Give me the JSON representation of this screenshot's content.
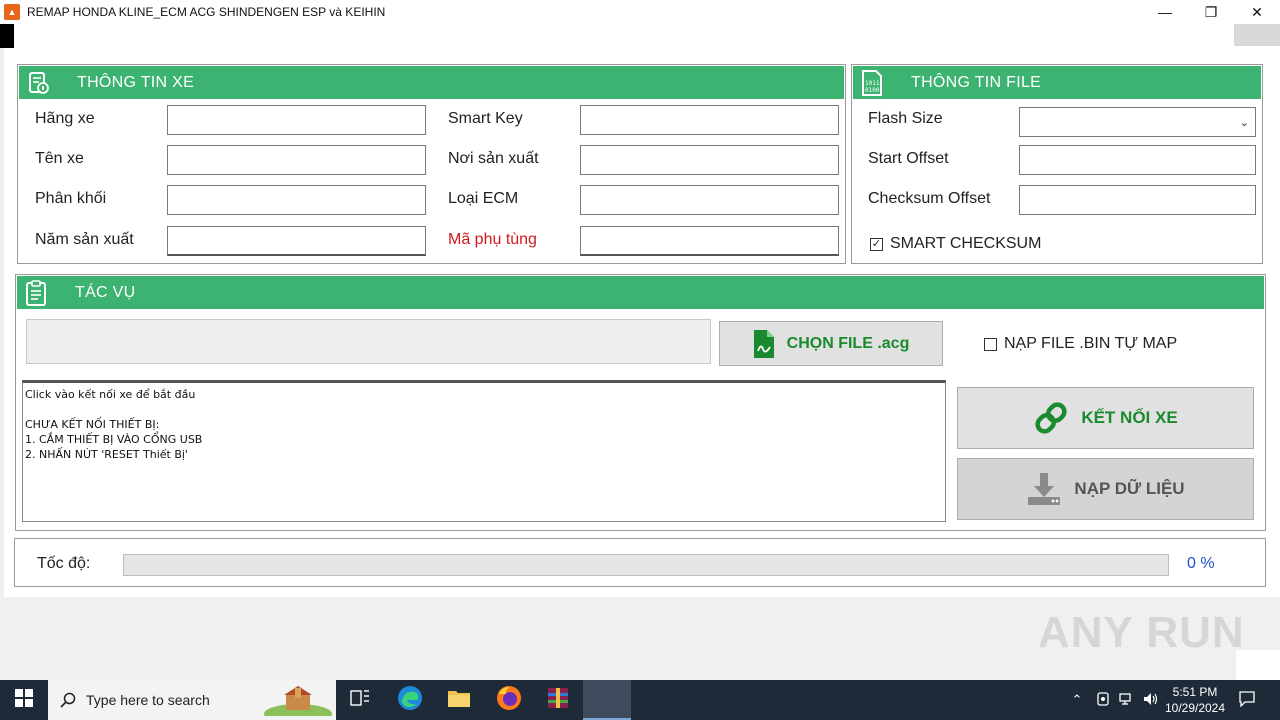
{
  "window": {
    "title": "REMAP HONDA KLINE_ECM ACG SHINDENGEN ESP và KEIHIN",
    "minimize": "—",
    "restore": "❐",
    "close": "✕"
  },
  "vehicle_info": {
    "title": "THÔNG TIN XE",
    "fields_left": [
      {
        "label": "Hãng xe",
        "value": ""
      },
      {
        "label": "Tên xe",
        "value": ""
      },
      {
        "label": "Phân khối",
        "value": ""
      },
      {
        "label": "Năm sản xuất",
        "value": ""
      }
    ],
    "fields_right": [
      {
        "label": "Smart Key",
        "value": ""
      },
      {
        "label": "Nơi sản xuất",
        "value": ""
      },
      {
        "label": "Loại ECM",
        "value": ""
      },
      {
        "label": "Mã phụ tùng",
        "value": ""
      }
    ]
  },
  "file_info": {
    "title": "THÔNG TIN FILE",
    "flash_size_label": "Flash Size",
    "flash_size_value": "",
    "start_offset_label": "Start Offset",
    "start_offset_value": "",
    "checksum_offset_label": "Checksum Offset",
    "checksum_offset_value": "",
    "smart_checksum_label": "SMART CHECKSUM",
    "smart_checksum_checked": true
  },
  "tasks": {
    "title": "TÁC VỤ",
    "file_path": "",
    "choose_file_label": "CHỌN FILE .acg",
    "load_bin_label": "NẠP FILE .BIN TỰ MAP",
    "load_bin_checked": false,
    "connect_label": "KẾT NỐI XE",
    "write_label": "NẠP DỮ LIỆU",
    "log_lines": [
      "Click vào kết nối xe để bắt đầu",
      "",
      "CHƯA KẾT NỐI THIẾT BỊ:",
      "1. CẮM THIẾT BỊ VÀO CỔNG USB",
      "2. NHẤN NÚT 'RESET Thiết Bị'"
    ]
  },
  "speed": {
    "label": "Tốc độ:",
    "progress": 0,
    "percent_text": "0 %"
  },
  "watermark": "ANY RUN",
  "taskbar": {
    "search_placeholder": "Type here to search",
    "time": "5:51 PM",
    "date": "10/29/2024"
  },
  "colors": {
    "panel_header": "#3cb371",
    "accent_green": "#1a8a2e",
    "required_label": "#d0191e"
  }
}
